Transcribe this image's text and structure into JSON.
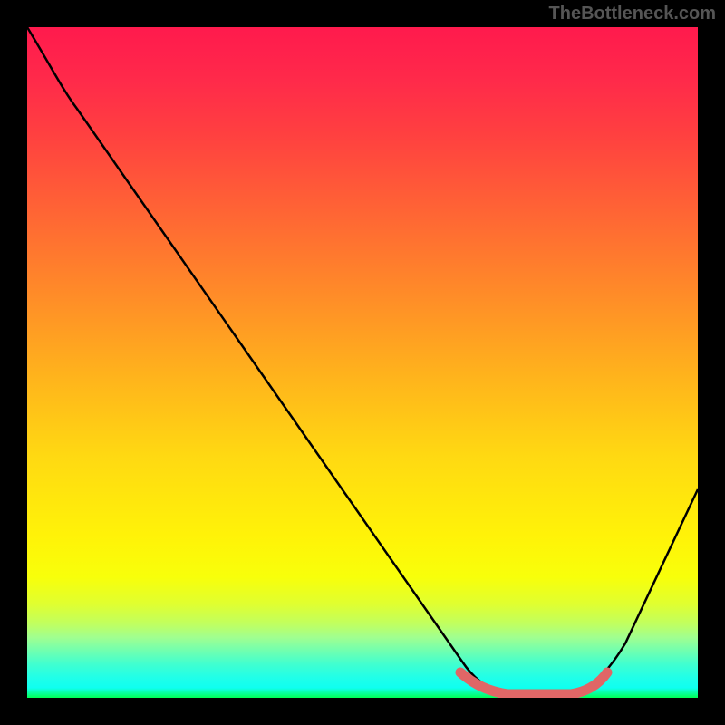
{
  "watermark": "TheBottleneck.com",
  "chart_data": {
    "type": "line",
    "title": "",
    "xlabel": "",
    "ylabel": "",
    "xlim": [
      0,
      100
    ],
    "ylim": [
      0,
      100
    ],
    "series": [
      {
        "name": "bottleneck-curve",
        "x": [
          0,
          6,
          10,
          20,
          30,
          40,
          50,
          60,
          64,
          68,
          72,
          76,
          80,
          84,
          90,
          100
        ],
        "values": [
          100,
          92,
          88,
          75,
          62,
          49,
          36,
          22,
          14,
          7,
          2,
          0,
          0,
          2,
          10,
          32
        ]
      },
      {
        "name": "optimal-range-highlight",
        "x": [
          64,
          68,
          72,
          76,
          80,
          84
        ],
        "values": [
          3,
          1,
          0,
          0,
          1,
          3
        ]
      }
    ],
    "gradient_stops": [
      {
        "pos": 0,
        "color": "#ff1a4d"
      },
      {
        "pos": 0.5,
        "color": "#ffd000"
      },
      {
        "pos": 0.85,
        "color": "#ffff00"
      },
      {
        "pos": 1.0,
        "color": "#00ff55"
      }
    ]
  }
}
